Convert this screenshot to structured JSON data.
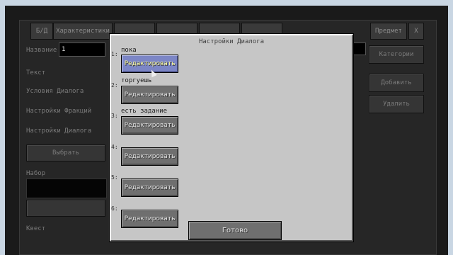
{
  "background": {
    "tabs": [
      "Б/Д",
      "Характеристики",
      "",
      "",
      "",
      "",
      "Предмет",
      "X"
    ],
    "labels": [
      "Название",
      "Текст",
      "Условия Диалога",
      "Настройки Фракций",
      "Настройки Диалога",
      "Набор",
      "Квест",
      "Задание"
    ],
    "name_value": "1",
    "buttons": [
      "Категории",
      "Добавить",
      "Удалить",
      "Выбрать"
    ]
  },
  "dialog": {
    "title": "Настройки Диалога",
    "rows": [
      {
        "num": "1:",
        "label": "пока",
        "button": "Редактировать",
        "hover": true
      },
      {
        "num": "2:",
        "label": "торгуешь",
        "button": "Редактировать",
        "hover": false
      },
      {
        "num": "3:",
        "label": "есть задание",
        "button": "Редактировать",
        "hover": false
      },
      {
        "num": "4:",
        "label": "",
        "button": "Редактировать",
        "hover": false
      },
      {
        "num": "5:",
        "label": "",
        "button": "Редактировать",
        "hover": false
      },
      {
        "num": "6:",
        "label": "",
        "button": "Редактировать",
        "hover": false
      }
    ],
    "done_label": "Готово"
  },
  "colors": {
    "button_gray": "#6f6f6f",
    "button_hover": "#7c86c6",
    "panel": "#c6c6c6"
  }
}
